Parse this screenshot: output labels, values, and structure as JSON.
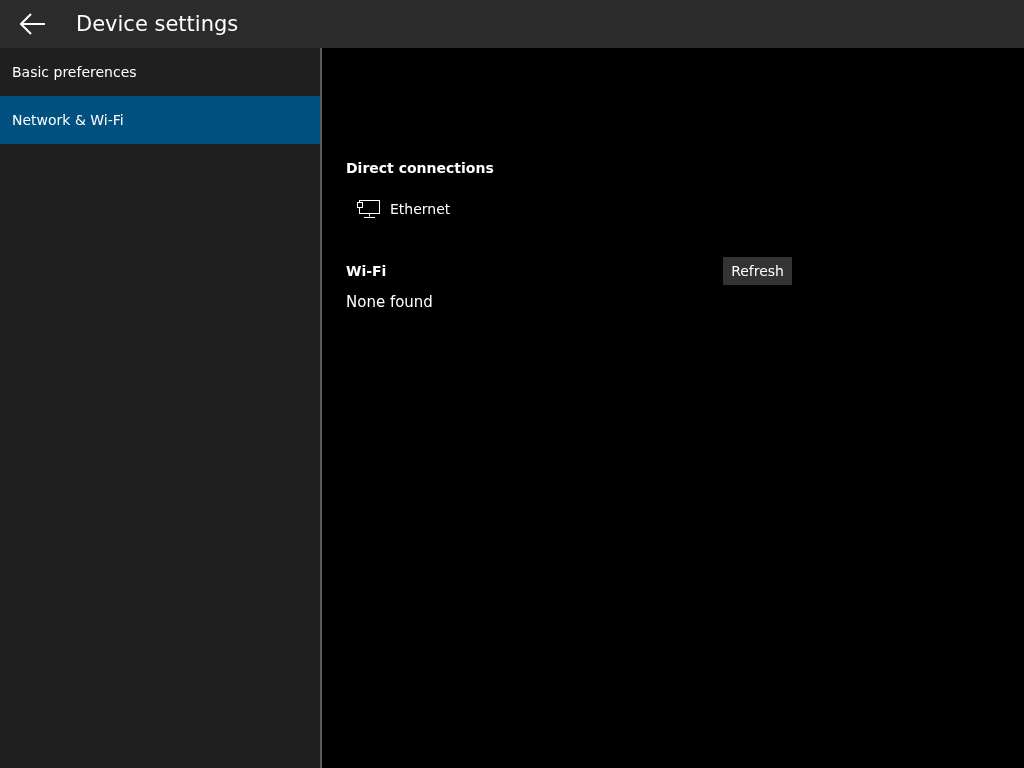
{
  "header": {
    "title": "Device settings"
  },
  "sidebar": {
    "items": [
      {
        "label": "Basic preferences",
        "selected": false
      },
      {
        "label": "Network & Wi-Fi",
        "selected": true
      }
    ]
  },
  "direct_connections": {
    "heading": "Direct connections",
    "items": [
      {
        "label": "Ethernet"
      }
    ]
  },
  "wifi": {
    "heading": "Wi-Fi",
    "refresh_button": "Refresh",
    "status": "None found"
  }
}
